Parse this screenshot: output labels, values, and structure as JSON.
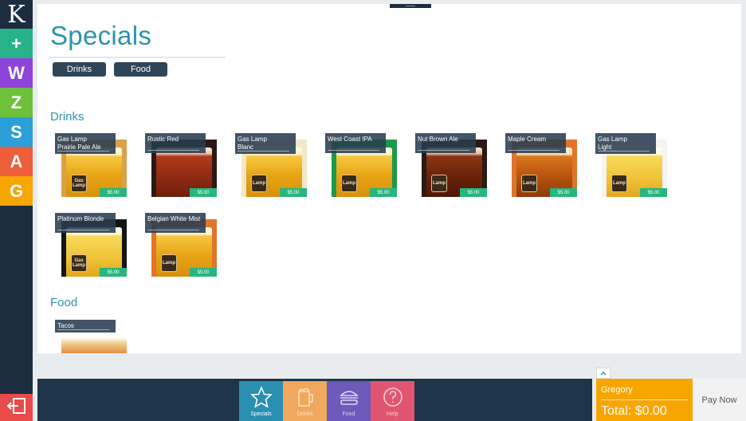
{
  "rail": {
    "logo": "K",
    "buttons": [
      {
        "label": "+",
        "color": "#27b38a"
      },
      {
        "label": "W",
        "color": "#8e44d9"
      },
      {
        "label": "Z",
        "color": "#6ec13b"
      },
      {
        "label": "S",
        "color": "#2b9fd9"
      },
      {
        "label": "A",
        "color": "#ee5e3b"
      },
      {
        "label": "G",
        "color": "#f7a600"
      }
    ],
    "exit_icon": "exit-icon",
    "exit_color": "#e94a4a"
  },
  "page": {
    "title": "Specials",
    "chips": [
      "Drinks",
      "Food"
    ]
  },
  "sections": [
    {
      "title": "Drinks",
      "items": [
        {
          "name_line1": "Gas Lamp",
          "name_line2": "Prairie Pale Ale",
          "price": "$5.00",
          "badge": "Gas Lamp"
        },
        {
          "name_line1": "Rustic Red",
          "name_line2": "",
          "price": "$5.00",
          "badge": ""
        },
        {
          "name_line1": "Gas Lamp",
          "name_line2": "Blanc",
          "price": "$5.00",
          "badge": "Lamp"
        },
        {
          "name_line1": "West Coast IPA",
          "name_line2": "",
          "price": "$5.00",
          "badge": "Lamp"
        },
        {
          "name_line1": "Nut Brown Ale",
          "name_line2": "",
          "price": "$5.00",
          "badge": "Lamp"
        },
        {
          "name_line1": "Maple Cream",
          "name_line2": "",
          "price": "$5.00",
          "badge": "Lamp"
        },
        {
          "name_line1": "Gas Lamp",
          "name_line2": "Light",
          "price": "$5.00",
          "badge": "Lamp"
        },
        {
          "name_line1": "Platinum Blonde",
          "name_line2": "",
          "price": "$5.00",
          "badge": "Gas Lamp"
        },
        {
          "name_line1": "Belgian White Mist",
          "name_line2": "",
          "price": "$5.00",
          "badge": "Lamp"
        }
      ]
    },
    {
      "title": "Food",
      "items": [
        {
          "name_line1": "Tacos",
          "name_line2": ""
        }
      ]
    }
  ],
  "bottom_nav": [
    {
      "label": "Specials",
      "icon": "star-icon",
      "color": "#2a8fb0"
    },
    {
      "label": "Drinks",
      "icon": "beer-mug-icon",
      "color": "#f0a95c"
    },
    {
      "label": "Food",
      "icon": "burger-icon",
      "color": "#6c5bbb"
    },
    {
      "label": "Help",
      "icon": "question-icon",
      "color": "#e05670"
    }
  ],
  "order": {
    "customer": "Gregory",
    "total": "Total: $0.00",
    "pay_label": "Pay Now",
    "expand_icon": "chevron-up-icon"
  }
}
